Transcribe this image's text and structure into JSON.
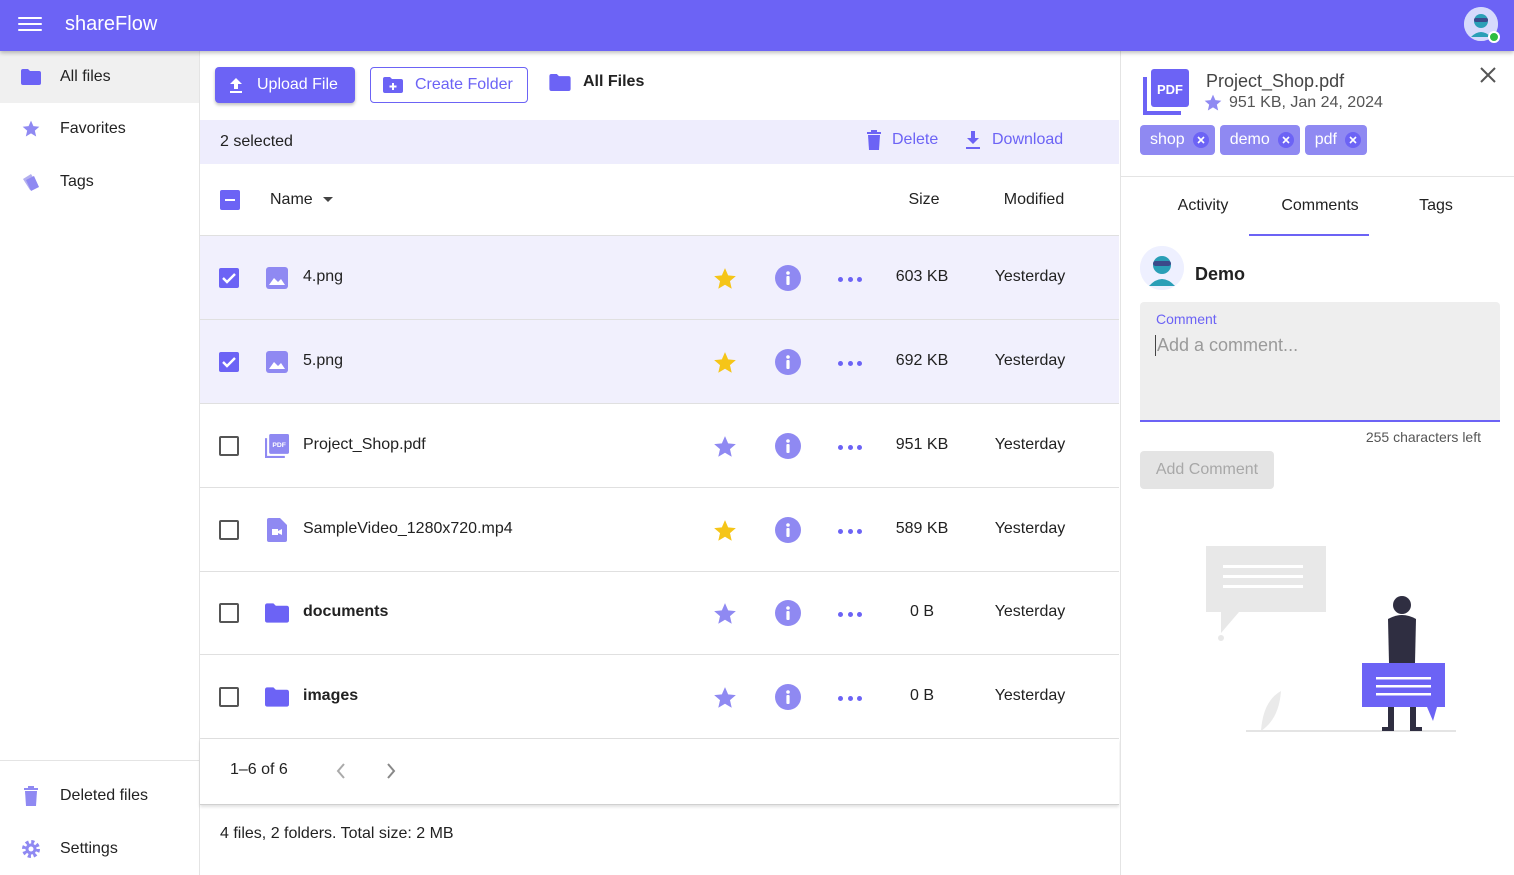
{
  "app": {
    "title": "shareFlow"
  },
  "colors": {
    "accent": "#6c63f5",
    "accent_light": "#8f89f2",
    "selected_row": "#f1f0fd",
    "star_on": "#f5c518"
  },
  "sidebar": {
    "items": [
      {
        "label": "All files",
        "icon": "folder-icon",
        "active": true
      },
      {
        "label": "Favorites",
        "icon": "star-icon"
      },
      {
        "label": "Tags",
        "icon": "tag-icon"
      }
    ],
    "bottom_items": [
      {
        "label": "Deleted files",
        "icon": "trash-icon"
      },
      {
        "label": "Settings",
        "icon": "gear-icon"
      }
    ]
  },
  "toolbar": {
    "upload_label": "Upload File",
    "create_folder_label": "Create Folder",
    "breadcrumb": "All Files"
  },
  "selection": {
    "count_label": "2 selected",
    "delete_label": "Delete",
    "download_label": "Download"
  },
  "table": {
    "headers": {
      "name": "Name",
      "size": "Size",
      "modified": "Modified"
    },
    "rows": [
      {
        "name": "4.png",
        "type": "image",
        "favorite": true,
        "selected": true,
        "size": "603 KB",
        "modified": "Yesterday"
      },
      {
        "name": "5.png",
        "type": "image",
        "favorite": true,
        "selected": true,
        "size": "692 KB",
        "modified": "Yesterday"
      },
      {
        "name": "Project_Shop.pdf",
        "type": "pdf",
        "favorite": false,
        "selected": false,
        "size": "951 KB",
        "modified": "Yesterday"
      },
      {
        "name": "SampleVideo_1280x720.mp4",
        "type": "video",
        "favorite": true,
        "selected": false,
        "size": "589 KB",
        "modified": "Yesterday"
      },
      {
        "name": "documents",
        "type": "folder",
        "favorite": false,
        "selected": false,
        "size": "0 B",
        "modified": "Yesterday"
      },
      {
        "name": "images",
        "type": "folder",
        "favorite": false,
        "selected": false,
        "size": "0 B",
        "modified": "Yesterday"
      }
    ]
  },
  "pagination": {
    "range": "1–6 of 6"
  },
  "summary": "4 files, 2 folders. Total size: 2 MB",
  "details": {
    "file_name": "Project_Shop.pdf",
    "meta": "951 KB, Jan 24, 2024",
    "tags": [
      "shop",
      "demo",
      "pdf"
    ],
    "tabs": [
      "Activity",
      "Comments",
      "Tags"
    ],
    "active_tab": "Comments",
    "user_name": "Demo",
    "comment_label": "Comment",
    "comment_placeholder": "Add a comment...",
    "chars_left": "255 characters left",
    "add_comment_label": "Add Comment"
  }
}
